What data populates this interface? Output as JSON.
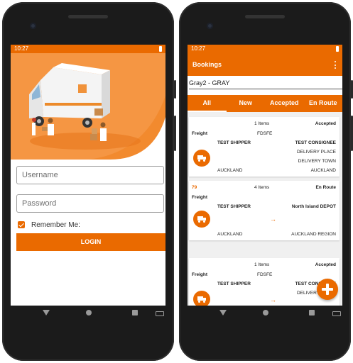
{
  "status_bar": {
    "time": "10:27"
  },
  "login": {
    "username_placeholder": "Username",
    "password_placeholder": "Password",
    "remember_label": "Remember Me:",
    "login_button": "LOGIN"
  },
  "bookings": {
    "title": "Bookings",
    "account": "Gray2 - GRAY",
    "tabs": [
      {
        "label": "All",
        "active": true
      },
      {
        "label": "New",
        "active": false
      },
      {
        "label": "Accepted",
        "active": false
      },
      {
        "label": "En Route",
        "active": false
      }
    ],
    "cards": [
      {
        "ref": "",
        "items": "1 Items",
        "status": "Accepted",
        "type": "Freight",
        "code": "FDSFE",
        "shipper": "TEST SHIPPER",
        "consignee": "TEST CONSIGNEE",
        "line2": "DELIVERY PLACE",
        "line3": "DELIVERY TOWN",
        "origin": "AUCKLAND",
        "destination": "AUCKLAND"
      },
      {
        "ref": "79",
        "items": "4 Items",
        "status": "En Route",
        "type": "Freight",
        "code": "",
        "shipper": "TEST SHIPPER",
        "consignee": "North Island DEPOT",
        "line2": "",
        "line3": "",
        "origin": "AUCKLAND",
        "destination": "AUCKLAND REGION"
      },
      {
        "ref": "",
        "items": "1 Items",
        "status": "Accepted",
        "type": "Freight",
        "code": "FDSFE",
        "shipper": "TEST SHIPPER",
        "consignee": "TEST CONSIGNEE",
        "line2": "DELIVERY PLACE",
        "line3": "",
        "origin": "",
        "destination": ""
      }
    ]
  },
  "colors": {
    "accent": "#ea6a00"
  },
  "icons": [
    "battery-icon",
    "more-vert-icon",
    "truck-icon",
    "arrow-right-icon",
    "plus-icon",
    "check-icon",
    "back-icon",
    "home-icon",
    "recent-apps-icon",
    "keyboard-icon"
  ]
}
